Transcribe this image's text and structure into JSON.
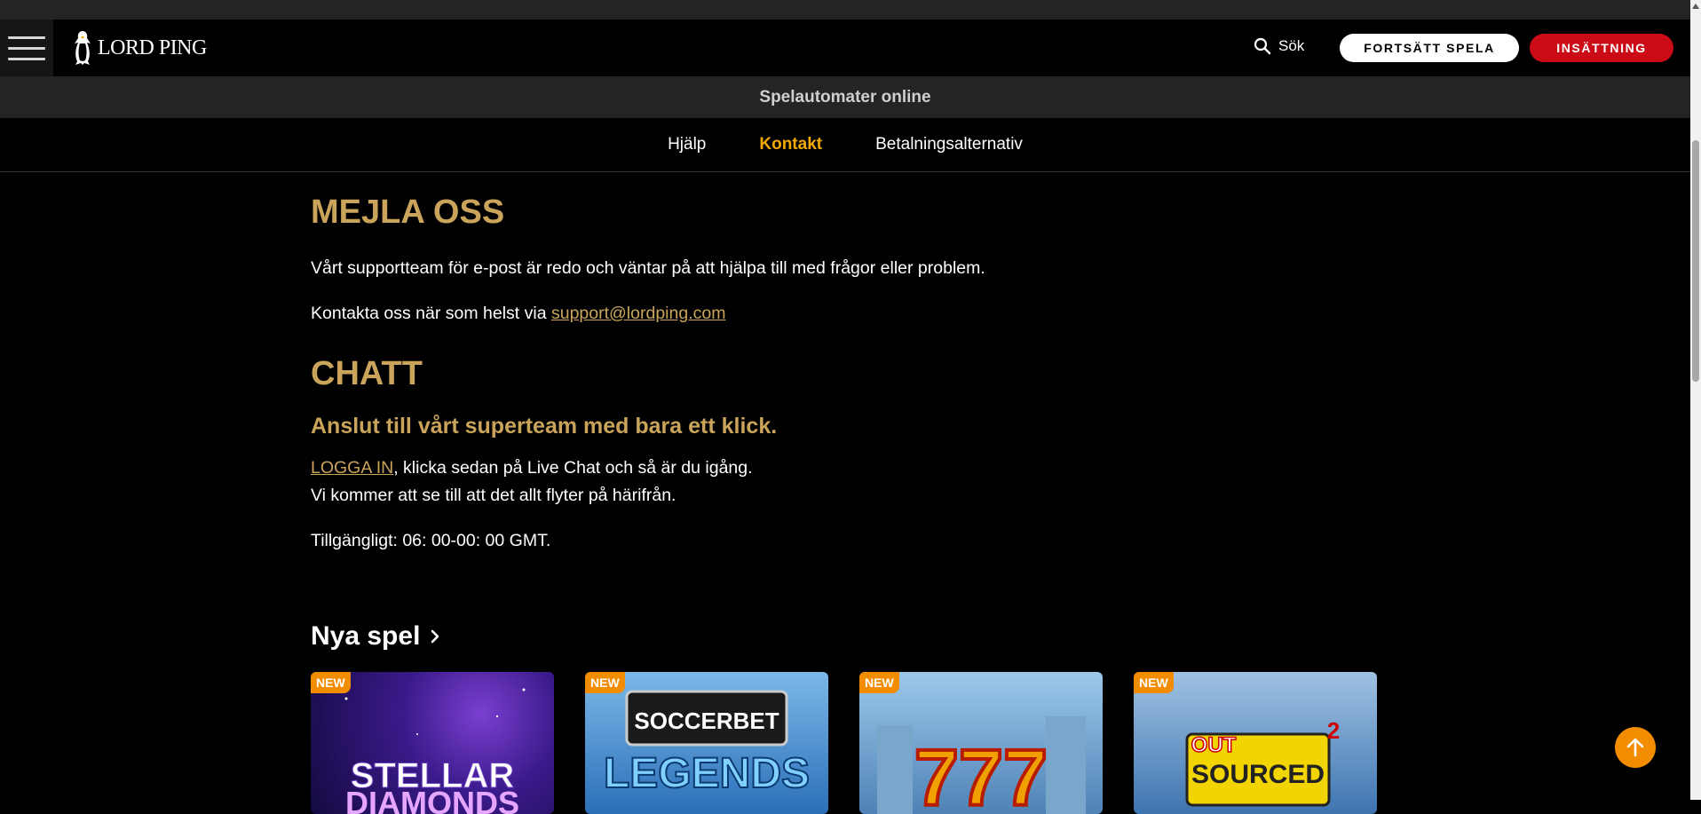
{
  "header": {
    "brand": "LORD PING",
    "search_label": "Sök",
    "continue_label": "FORTSÄTT SPELA",
    "deposit_label": "INSÄTTNING"
  },
  "subheader": {
    "title": "Spelautomater online"
  },
  "subnav": {
    "items": [
      "Hjälp",
      "Kontakt",
      "Betalningsalternativ"
    ],
    "active": "Kontakt"
  },
  "email_section": {
    "title": "MEJLA OSS",
    "text1": "Vårt supportteam för e-post är redo och väntar på att hjälpa till med frågor eller problem.",
    "text2_prefix": "Kontakta oss när som helst via ",
    "email": "support@lordping.com"
  },
  "chat_section": {
    "title": "CHATT",
    "subtitle": "Anslut till vårt superteam med bara ett klick.",
    "login_link": "LOGGA IN",
    "line1_suffix": ", klicka sedan på Live Chat och så är du igång.",
    "line2": "Vi kommer att se till att det allt flyter på härifrån.",
    "availability": "Tillgängligt: 06: 00-00: 00 GMT."
  },
  "new_games": {
    "title": "Nya spel",
    "badge": "NEW",
    "games": [
      "STELLAR DIAMONDS",
      "SOCCERBET LEGENDS",
      "777",
      "OUT SOURCED 2"
    ]
  },
  "colors": {
    "gold": "#c9a45a",
    "accent": "#f2a900",
    "deposit": "#cb0c16",
    "badge": "#f28c00"
  }
}
